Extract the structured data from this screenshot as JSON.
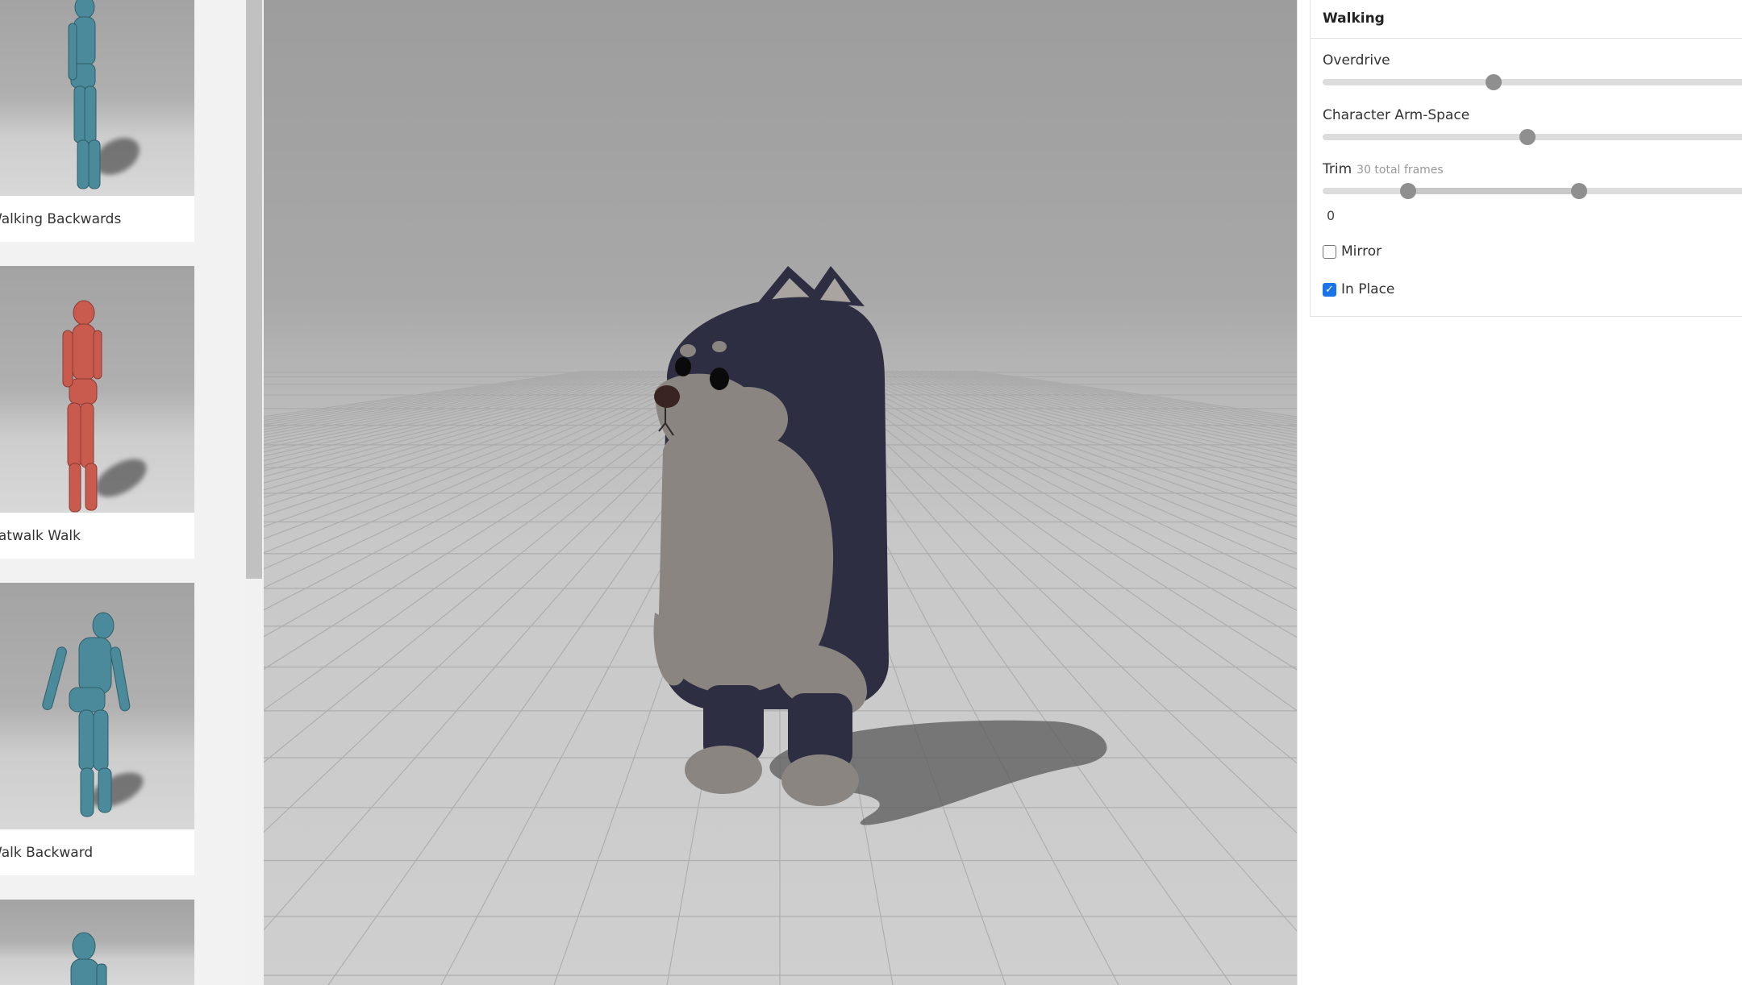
{
  "animations": [
    {
      "label": "Walking Backwards",
      "figure_color": "#4a8a9a"
    },
    {
      "label": "Catwalk Walk",
      "figure_color": "#c95a4e"
    },
    {
      "label": "Walk Backward",
      "figure_color": "#4a8a9a"
    },
    {
      "label": "",
      "figure_color": "#4a8a9a"
    }
  ],
  "settings": {
    "title": "Walking",
    "overdrive": {
      "label": "Overdrive",
      "value": 0.4
    },
    "arm_space": {
      "label": "Character Arm-Space",
      "value": 0.48
    },
    "trim": {
      "label": "Trim",
      "sub": "30 total frames",
      "start": 0.2,
      "end": 0.6,
      "start_value": "0"
    },
    "mirror": {
      "label": "Mirror",
      "checked": false
    },
    "in_place": {
      "label": "In Place",
      "checked": true
    }
  },
  "colors": {
    "accent": "#1a73e8",
    "character_body": "#2e2e42",
    "character_belly": "#8a8580"
  }
}
